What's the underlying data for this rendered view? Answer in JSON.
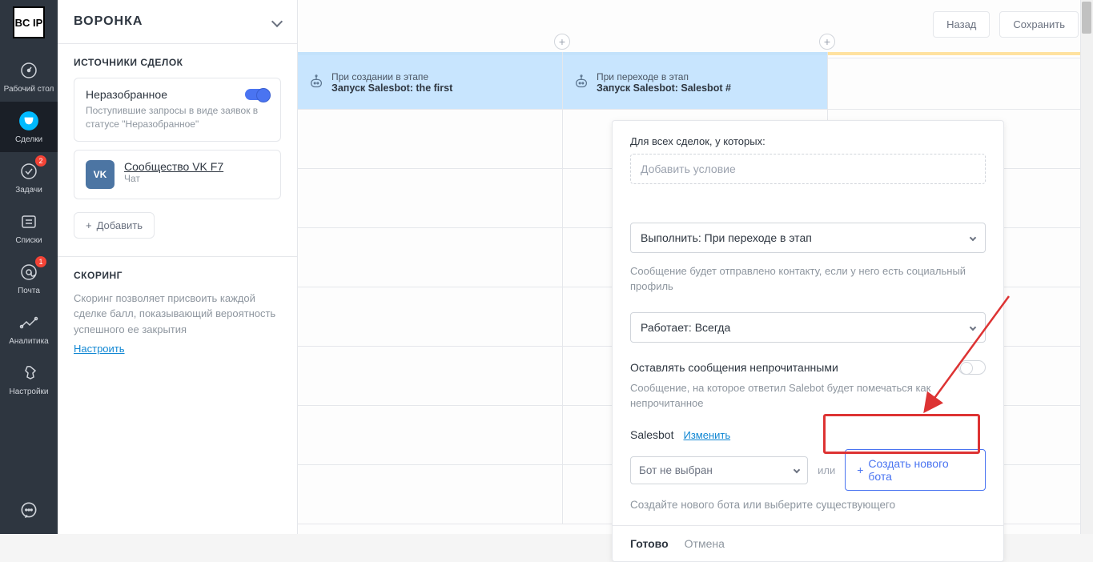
{
  "nav": {
    "logo": "BC\nIP",
    "items": [
      {
        "label": "Рабочий стол",
        "icon": "dashboard-icon"
      },
      {
        "label": "Сделки",
        "icon": "deals-icon"
      },
      {
        "label": "Задачи",
        "icon": "tasks-icon",
        "badge": "2"
      },
      {
        "label": "Списки",
        "icon": "lists-icon"
      },
      {
        "label": "Почта",
        "icon": "mail-icon",
        "badge": "1"
      },
      {
        "label": "Аналитика",
        "icon": "analytics-icon"
      },
      {
        "label": "Настройки",
        "icon": "settings-icon"
      }
    ]
  },
  "sidebar": {
    "title": "ВОРОНКА",
    "sources_title": "ИСТОЧНИКИ СДЕЛОК",
    "unassigned": {
      "name": "Неразобранное",
      "desc": "Поступившие запросы в виде заявок в статусе \"Неразобранное\""
    },
    "vk": {
      "name": "Сообщество VK F7",
      "sub": "Чат"
    },
    "add_label": "Добавить",
    "scoring_title": "СКОРИНГ",
    "scoring_desc": "Скоринг позволяет присвоить каждой сделке балл, показывающий вероятность успешного ее закрытия",
    "scoring_link": "Настроить"
  },
  "topbar": {
    "back": "Назад",
    "save": "Сохранить"
  },
  "stages": {
    "col1": {
      "line1": "При создании в этапе",
      "line2": "Запуск Salesbot: the first"
    },
    "col2": {
      "line1": "При переходе в этап",
      "line2": "Запуск Salesbot: Salesbot #"
    }
  },
  "popup": {
    "filter_label": "Для всех сделок, у которых:",
    "add_condition_placeholder": "Добавить условие",
    "execute_select": "Выполнить: При переходе в этап",
    "execute_hint": "Сообщение будет отправлено контакту, если у него есть социальный профиль",
    "works_select": "Работает: Всегда",
    "unread_label": "Оставлять сообщения непрочитанными",
    "unread_hint": "Сообщение, на которое ответил Salebot будет помечаться как непрочитанное",
    "salesbot_label": "Salesbot",
    "change_link": "Изменить",
    "bot_select": "Бот не выбран",
    "or": "или",
    "create_bot": "Создать нового бота",
    "create_hint": "Создайте нового бота или выберите существующего",
    "done": "Готово",
    "cancel": "Отмена"
  }
}
